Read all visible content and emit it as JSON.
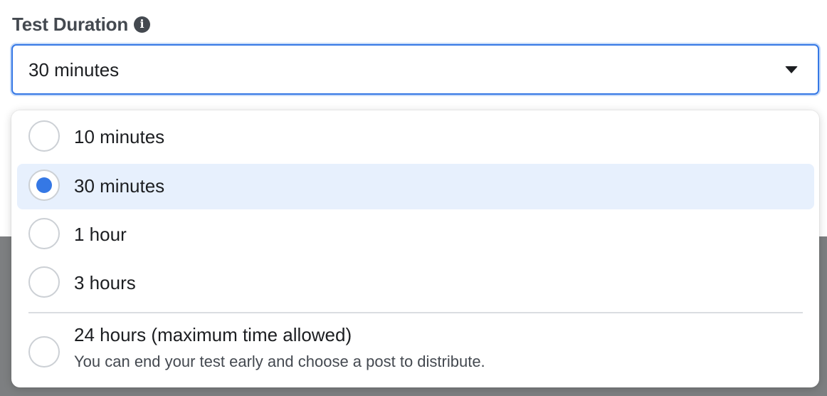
{
  "field": {
    "label": "Test Duration",
    "info_glyph": "i",
    "selected_value": "30 minutes"
  },
  "options": [
    {
      "label": "10 minutes",
      "selected": false
    },
    {
      "label": "30 minutes",
      "selected": true
    },
    {
      "label": "1 hour",
      "selected": false
    },
    {
      "label": "3 hours",
      "selected": false
    },
    {
      "label": "24 hours (maximum time allowed)",
      "description": "You can end your test early and choose a post to distribute.",
      "selected": false
    }
  ],
  "colors": {
    "accent": "#3578e5",
    "selected_row": "#e7f0fd",
    "backdrop": "#7d7f81"
  },
  "icons": {
    "info": "info-icon",
    "caret": "caret-down-icon"
  }
}
